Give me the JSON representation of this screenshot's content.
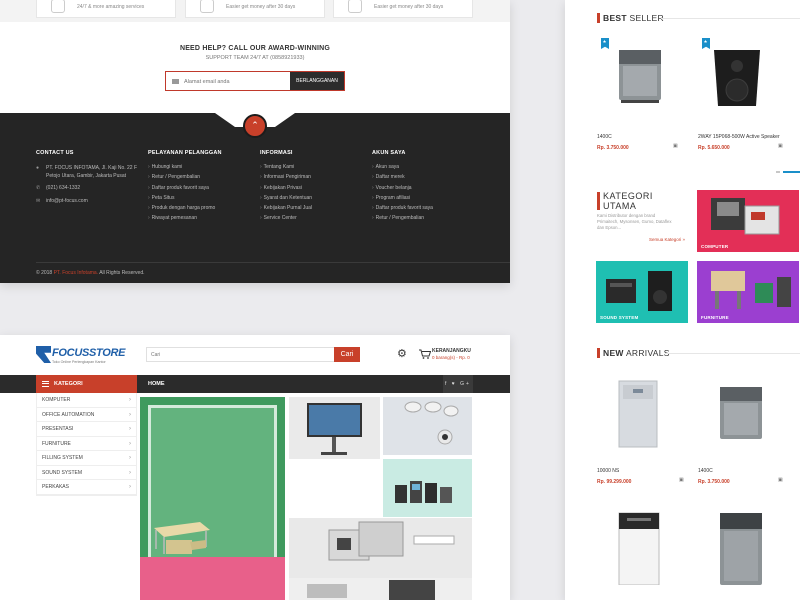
{
  "features": [
    {
      "text": "24/7 & more amazing services"
    },
    {
      "text": "Easier get money after 30 days"
    },
    {
      "text": "Easier get money after 30 days"
    }
  ],
  "newsletter": {
    "title": "NEED HELP? CALL OUR AWARD-WINNING",
    "subtitle": "SUPPORT TEAM 24/7 AT (0858921933)",
    "placeholder": "Alamat email anda",
    "button": "BERLANGGANAN"
  },
  "footer": {
    "contact": {
      "title": "CONTACT US",
      "address": "PT. FOCUS INFOTAMA, Jl. Kaji No. 22 F Petojo Utara, Gambir, Jakarta Pusat",
      "phone": "(021) 634-1332",
      "email": "info@pt-focus.com"
    },
    "col2": {
      "title": "PELAYANAN PELANGGAN",
      "items": [
        "Hubungi kami",
        "Retur / Pengembalian",
        "Daftar produk favorit saya",
        "Peta Situs",
        "Produk dengan harga promo",
        "Riwayat pemesanan"
      ]
    },
    "col3": {
      "title": "INFORMASI",
      "items": [
        "Tentang Kami",
        "Informasi Pengiriman",
        "Kebijakan Privasi",
        "Syarat dan Ketentuan",
        "Kebijakan Purnal Jual",
        "Service Center"
      ]
    },
    "col4": {
      "title": "AKUN SAYA",
      "items": [
        "Akun saya",
        "Daftar merek",
        "Voucher belanja",
        "Program afiliasi",
        "Daftar produk favorit saya",
        "Retur / Pengembalian"
      ]
    },
    "copyright_pre": "© 2018",
    "copyright_brand": "PT. Focus Infotama.",
    "copyright_post": "All Rights Reserved."
  },
  "header": {
    "logo_name": "FOCUSSTORE",
    "logo_tag": "Toko Online Perlengkapan Kantor",
    "search_placeholder": "Cari",
    "search_button": "Cari",
    "cart_label": "KERANJANGKU",
    "cart_sub": "0 barang(s) - Rp. 0"
  },
  "nav": {
    "category": "KATEGORI",
    "home": "HOME",
    "social": "f ♥ G+"
  },
  "categories": [
    "KOMPUTER",
    "OFFICE AUTOMATION",
    "PRESENTASI",
    "FURNITURE",
    "FILLING SYSTEM",
    "SOUND SYSTEM",
    "PERKAKAS"
  ],
  "best_seller": {
    "title_bold": "BEST",
    "title_rest": "SELLER",
    "products": [
      {
        "name": "1400C",
        "price": "Rp. 3.750.000"
      },
      {
        "name": "2WAY 15P068-500W Active Speaker",
        "price": "Rp. 5.650.000"
      }
    ]
  },
  "kategori_utama": {
    "title_line1": "KATEGORI",
    "title_line2": "UTAMA",
    "desc": "Kami Distributor dengan brand Primaitech, Mysonsen, Gumo, Dataflex dan Epson...",
    "link": "Semua Kategori »",
    "tiles": [
      "COMPUTER",
      "SOUND SYSTEM",
      "FURNITURE"
    ]
  },
  "new_arrivals": {
    "title_bold": "NEW",
    "title_rest": "ARRIVALS",
    "products": [
      {
        "name": "10000 NS",
        "price": "Rp. 99.299.000"
      },
      {
        "name": "1400C",
        "price": "Rp. 3.750.000"
      }
    ]
  },
  "colors": {
    "accent": "#c8402a",
    "brand_blue": "#1f5fa8",
    "dark": "#252525",
    "badge": "#1a8fc9"
  },
  "icons": [
    "mail-icon",
    "chevron-up-icon",
    "map-pin-icon",
    "phone-icon",
    "email-icon",
    "search-icon",
    "gear-icon",
    "cart-icon",
    "menu-icon",
    "chevron-right-icon",
    "bookmark-star-icon"
  ]
}
